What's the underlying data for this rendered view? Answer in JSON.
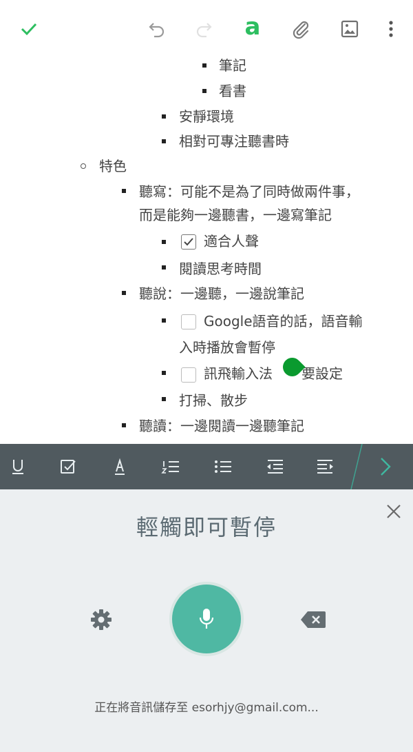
{
  "toolbar": {
    "done": "check-icon",
    "undo": "undo-icon",
    "redo": "redo-icon",
    "format_label": "a",
    "attach": "paperclip-icon",
    "image": "image-icon",
    "more": "more-vert-icon",
    "accent": "#2dbe60"
  },
  "note": {
    "lines": [
      "筆記",
      "看書",
      "安靜環境",
      "相對可專注聽書時",
      "特色",
      "聽寫：可能不是為了同時做兩件事，",
      "而是能夠一邊聽書，一邊寫筆記",
      "適合人聲",
      "閱讀思考時間",
      "聽說：一邊聽，一邊說筆記",
      "Google語音的話，語音輸",
      "入時播放會暫停",
      "訊飛輸入法",
      "要設定",
      "打掃、散步",
      "聽讀：一邊閱讀一邊聽筆記"
    ]
  },
  "format_bar": {
    "background": "#505a5f",
    "icons": [
      "underline-icon",
      "checkbox-icon",
      "highlighter-icon",
      "numbered-list-icon",
      "bulleted-list-icon",
      "outdent-icon",
      "indent-icon",
      "chevron-right-icon"
    ]
  },
  "voice": {
    "prompt": "輕觸即可暫停",
    "status": "正在將音訊儲存至 esorhjy@gmail.com...",
    "mic_color": "#4fb8a3"
  }
}
